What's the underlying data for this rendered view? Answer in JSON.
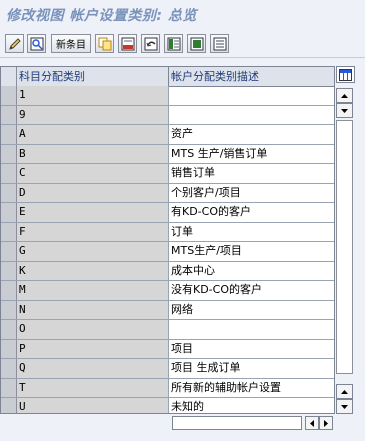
{
  "title": "修改视图 帐户设置类别: 总览",
  "toolbar": {
    "new_entries_label": "新条目"
  },
  "grid": {
    "col_code_header": "科目分配类别",
    "col_desc_header": "帐户分配类别描述",
    "rows": [
      {
        "code": "1",
        "desc": ""
      },
      {
        "code": "9",
        "desc": ""
      },
      {
        "code": "A",
        "desc": "资产"
      },
      {
        "code": "B",
        "desc": "MTS 生产/销售订单"
      },
      {
        "code": "C",
        "desc": "销售订单"
      },
      {
        "code": "D",
        "desc": "个别客户/项目"
      },
      {
        "code": "E",
        "desc": "有KD-CO的客户"
      },
      {
        "code": "F",
        "desc": "订单"
      },
      {
        "code": "G",
        "desc": "MTS生产/项目"
      },
      {
        "code": "K",
        "desc": "成本中心"
      },
      {
        "code": "M",
        "desc": "没有KD-CO的客户"
      },
      {
        "code": "N",
        "desc": "网络"
      },
      {
        "code": "O",
        "desc": ""
      },
      {
        "code": "P",
        "desc": "项目"
      },
      {
        "code": "Q",
        "desc": "项目 生成订单"
      },
      {
        "code": "T",
        "desc": "所有新的辅助帐户设置"
      },
      {
        "code": "U",
        "desc": "未知的"
      }
    ]
  },
  "icons": [
    "edit-icon",
    "display-icon",
    "copy-icon",
    "delete-icon",
    "undo-icon",
    "select-all-icon",
    "select-block-icon",
    "deselect-all-icon",
    "table-layout-icon"
  ]
}
